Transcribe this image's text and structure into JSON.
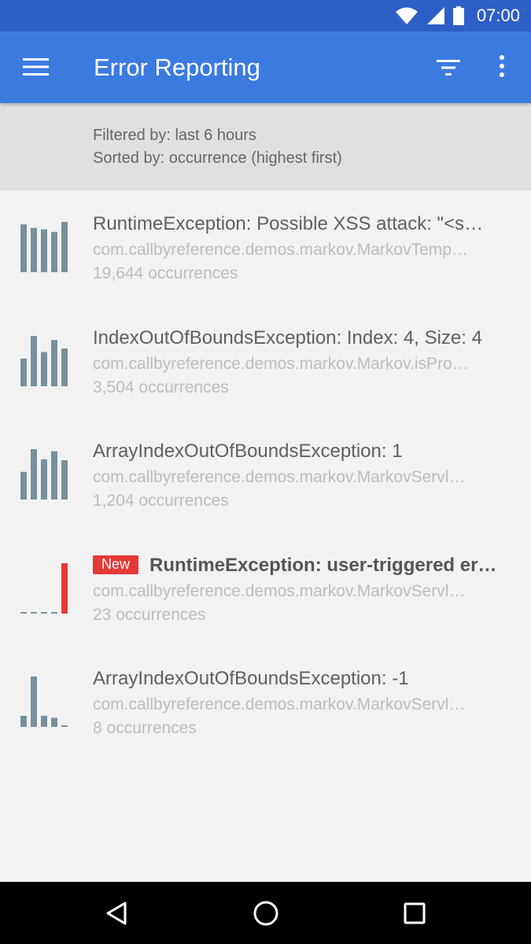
{
  "status_bar": {
    "time": "07:00",
    "icons": [
      "wifi-icon",
      "signal-icon",
      "battery-icon"
    ]
  },
  "app_bar": {
    "title": "Error Reporting",
    "icons": [
      "menu-icon",
      "filter-icon",
      "overflow-menu-icon"
    ]
  },
  "filter_banner": {
    "filtered_by": "Filtered by: last 6 hours",
    "sorted_by": "Sorted by: occurrence (highest first)"
  },
  "errors": [
    {
      "title": "RuntimeException: Possible XSS attack: \"<s…",
      "location": "com.callbyreference.demos.markov.MarkovTemp…",
      "occurrences": "19,644 occurrences",
      "is_new": false,
      "bars": [
        0.95,
        0.88,
        0.85,
        0.8,
        1.0
      ]
    },
    {
      "title": "IndexOutOfBoundsException: Index: 4, Size: 4",
      "location": "com.callbyreference.demos.markov.Markov.isPro…",
      "occurrences": "3,504 occurrences",
      "is_new": false,
      "bars": [
        0.55,
        1.0,
        0.68,
        0.92,
        0.75
      ]
    },
    {
      "title": "ArrayIndexOutOfBoundsException: 1",
      "location": "com.callbyreference.demos.markov.MarkovServl…",
      "occurrences": "1,204 occurrences",
      "is_new": false,
      "bars": [
        0.55,
        1.0,
        0.8,
        0.96,
        0.78
      ]
    },
    {
      "new_label": "New",
      "title": "RuntimeException: user-triggered er…",
      "location": "com.callbyreference.demos.markov.MarkovServl…",
      "occurrences": "23 occurrences",
      "is_new": true,
      "bars": [
        0,
        0,
        0,
        0,
        1.0
      ]
    },
    {
      "title": "ArrayIndexOutOfBoundsException: -1",
      "location": "com.callbyreference.demos.markov.MarkovServl…",
      "occurrences": "8 occurrences",
      "is_new": false,
      "bars": [
        0.22,
        1.0,
        0.22,
        0.18,
        0
      ]
    }
  ],
  "colors": {
    "status_bar": "#2d5fc7",
    "app_bar": "#3b7be0",
    "spark_normal": "#78909c",
    "spark_new": "#e53935",
    "badge": "#e53935"
  },
  "nav_bar": {
    "icons": [
      "back-icon",
      "home-icon",
      "recents-icon"
    ]
  }
}
